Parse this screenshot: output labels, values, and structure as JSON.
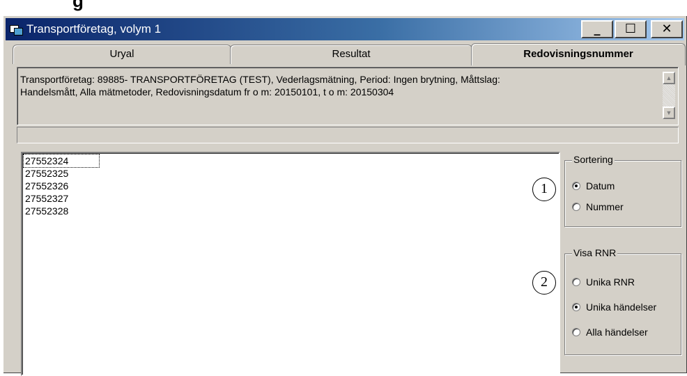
{
  "window": {
    "title": "Transportföretag, volym 1",
    "minimize_label": "_",
    "maximize_label": "☐",
    "close_label": "✕"
  },
  "cropped_heading": "g",
  "tabs": [
    {
      "label": "Uryal",
      "active": false
    },
    {
      "label": "Resultat",
      "active": false
    },
    {
      "label": "Redovisningsnummer",
      "active": true
    }
  ],
  "info": {
    "line1": "Transportföretag: 89885- TRANSPORTFÖRETAG (TEST), Vederlagsmätning, Period: Ingen brytning, Måttslag:",
    "line2": "Handelsmått, Alla mätmetoder, Redovisningsdatum  fr o m: 20150101, t o m: 20150304"
  },
  "list": {
    "items": [
      "27552324",
      "27552325",
      "27552326",
      "27552327",
      "27552328"
    ],
    "focused_index": 0
  },
  "sortering": {
    "label": "Sortering",
    "options": [
      {
        "label": "Datum",
        "checked": true
      },
      {
        "label": "Nummer",
        "checked": false
      }
    ]
  },
  "visa_rnr": {
    "label": "Visa RNR",
    "options": [
      {
        "label": "Unika RNR",
        "checked": false
      },
      {
        "label": "Unika händelser",
        "checked": true
      },
      {
        "label": "Alla händelser",
        "checked": false
      }
    ]
  },
  "callouts": [
    "1",
    "2"
  ],
  "colors": {
    "titlebar_start": "#0a246a",
    "titlebar_end": "#a6caf0",
    "face": "#d4d0c8"
  }
}
